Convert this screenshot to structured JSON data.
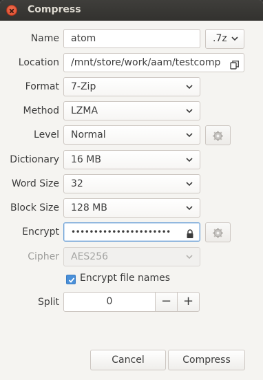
{
  "window": {
    "title": "Compress"
  },
  "labels": {
    "name": "Name",
    "location": "Location",
    "format": "Format",
    "method": "Method",
    "level": "Level",
    "dictionary": "Dictionary",
    "word_size": "Word Size",
    "block_size": "Block Size",
    "encrypt": "Encrypt",
    "cipher": "Cipher",
    "split": "Split"
  },
  "fields": {
    "name": "atom",
    "extension": ".7z",
    "location": "/mnt/store/work/aam/testcomp",
    "format": "7-Zip",
    "method": "LZMA",
    "level": "Normal",
    "dictionary": "16 MB",
    "word_size": "32",
    "block_size": "128 MB",
    "password": "••••••••••••••••••••••",
    "cipher": "AES256",
    "split": "0"
  },
  "checkbox": {
    "label": "Encrypt file names",
    "checked": true
  },
  "spin": {
    "minus": "−",
    "plus": "+"
  },
  "buttons": {
    "cancel": "Cancel",
    "compress": "Compress"
  },
  "icons": {
    "close": "close-icon",
    "gear": "gear-icon",
    "lock": "lock-icon",
    "folder": "copy-folder-icon",
    "chevron": "chevron-down-icon"
  },
  "colors": {
    "accent": "#4a90d9",
    "close": "#dc4a2c"
  }
}
